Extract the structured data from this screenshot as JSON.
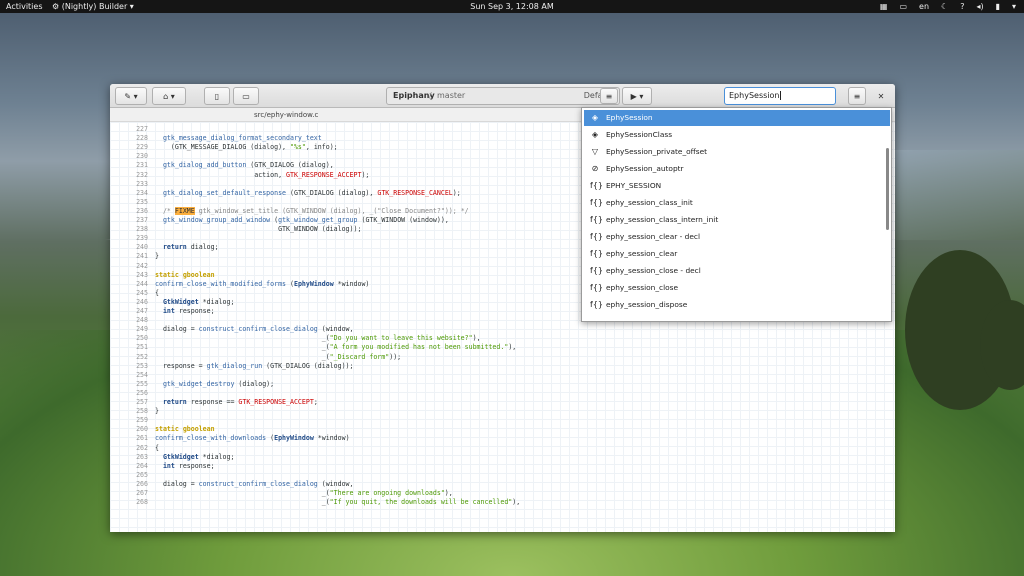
{
  "topbar": {
    "activities": "Activities",
    "app_icon": "wrench-icon",
    "app": "(Nightly) Builder ▾",
    "clock": "Sun Sep  3, 12:08 AM",
    "lang": "en"
  },
  "window": {
    "project": "Epiphany",
    "sep": "/",
    "branch": "master",
    "config": "Default",
    "search_value": "EphySession",
    "file_tab": "src/ephy-window.c"
  },
  "code": {
    "lines": [
      {
        "n": "227",
        "html": ""
      },
      {
        "n": "228",
        "html": "  <span class='fn'>gtk_message_dialog_format_secondary_text</span>"
      },
      {
        "n": "229",
        "html": "    (GTK_MESSAGE_DIALOG (dialog), <span class='str'>\"%s\"</span>, info);"
      },
      {
        "n": "230",
        "html": ""
      },
      {
        "n": "231",
        "html": "  <span class='fn'>gtk_dialog_add_button</span> (GTK_DIALOG (dialog),"
      },
      {
        "n": "232",
        "html": "                         action, <span class='mac'>GTK_RESPONSE_ACCEPT</span>);"
      },
      {
        "n": "233",
        "html": ""
      },
      {
        "n": "234",
        "html": "  <span class='fn'>gtk_dialog_set_default_response</span> (GTK_DIALOG (dialog), <span class='mac'>GTK_RESPONSE_CANCEL</span>);"
      },
      {
        "n": "235",
        "html": ""
      },
      {
        "n": "236",
        "html": "  <span class='cm'>/* <span class='hl'>FIXME</span> gtk_window_set_title (GTK_WINDOW (dialog), _(\"Close Document?\")); */</span>"
      },
      {
        "n": "237",
        "html": "  <span class='fn'>gtk_window_group_add_window</span> (<span class='fn'>gtk_window_get_group</span> (GTK_WINDOW (window)),"
      },
      {
        "n": "238",
        "html": "                               GTK_WINDOW (dialog));"
      },
      {
        "n": "239",
        "html": ""
      },
      {
        "n": "240",
        "html": "  <span class='kw2'>return</span> dialog;"
      },
      {
        "n": "241",
        "html": "}"
      },
      {
        "n": "242",
        "html": ""
      },
      {
        "n": "243",
        "html": "<span class='kw'>static</span> <span class='kw'>gboolean</span>"
      },
      {
        "n": "244",
        "html": "<span class='fn'>confirm_close_with_modified_forms</span> (<span class='kw2'>EphyWindow</span> *window)"
      },
      {
        "n": "245",
        "html": "{"
      },
      {
        "n": "246",
        "html": "  <span class='kw2'>GtkWidget</span> *dialog;"
      },
      {
        "n": "247",
        "html": "  <span class='kw2'>int</span> response;"
      },
      {
        "n": "248",
        "html": ""
      },
      {
        "n": "249",
        "html": "  dialog = <span class='fn'>construct_confirm_close_dialog</span> (window,"
      },
      {
        "n": "250",
        "html": "                                          _(<span class='str'>\"Do you want to leave this website?\"</span>),"
      },
      {
        "n": "251",
        "html": "                                          _(<span class='str'>\"A form you modified has not been submitted.\"</span>),"
      },
      {
        "n": "252",
        "html": "                                          _(<span class='str'>\"_Discard form\"</span>));"
      },
      {
        "n": "253",
        "html": "  response = <span class='fn'>gtk_dialog_run</span> (GTK_DIALOG (dialog));"
      },
      {
        "n": "254",
        "html": ""
      },
      {
        "n": "255",
        "html": "  <span class='fn'>gtk_widget_destroy</span> (dialog);"
      },
      {
        "n": "256",
        "html": ""
      },
      {
        "n": "257",
        "html": "  <span class='kw2'>return</span> response == <span class='mac'>GTK_RESPONSE_ACCEPT</span>;"
      },
      {
        "n": "258",
        "html": "}"
      },
      {
        "n": "259",
        "html": ""
      },
      {
        "n": "260",
        "html": "<span class='kw'>static</span> <span class='kw'>gboolean</span>"
      },
      {
        "n": "261",
        "html": "<span class='fn'>confirm_close_with_downloads</span> (<span class='kw2'>EphyWindow</span> *window)"
      },
      {
        "n": "262",
        "html": "{"
      },
      {
        "n": "263",
        "html": "  <span class='kw2'>GtkWidget</span> *dialog;"
      },
      {
        "n": "264",
        "html": "  <span class='kw2'>int</span> response;"
      },
      {
        "n": "265",
        "html": ""
      },
      {
        "n": "266",
        "html": "  dialog = <span class='fn'>construct_confirm_close_dialog</span> (window,"
      },
      {
        "n": "267",
        "html": "                                          _(<span class='str'>\"There are ongoing downloads\"</span>),"
      },
      {
        "n": "268",
        "html": "                                          _(<span class='str'>\"If you quit, the downloads will be cancelled\"</span>),"
      }
    ]
  },
  "completions": [
    {
      "icon": "class-icon",
      "glyph": "◈",
      "label": "EphySession",
      "selected": true
    },
    {
      "icon": "class-icon",
      "glyph": "◈",
      "label": "EphySessionClass"
    },
    {
      "icon": "field-icon",
      "glyph": "▽",
      "label": "EphySession_private_offset"
    },
    {
      "icon": "typedef-icon",
      "glyph": "⊘",
      "label": "EphySession_autoptr"
    },
    {
      "icon": "macro-icon",
      "glyph": "f{}",
      "label": "EPHY_SESSION"
    },
    {
      "icon": "function-icon",
      "glyph": "f{}",
      "label": "ephy_session_class_init"
    },
    {
      "icon": "function-icon",
      "glyph": "f{}",
      "label": "ephy_session_class_intern_init"
    },
    {
      "icon": "function-icon",
      "glyph": "f{}",
      "label": "ephy_session_clear - decl"
    },
    {
      "icon": "function-icon",
      "glyph": "f{}",
      "label": "ephy_session_clear"
    },
    {
      "icon": "function-icon",
      "glyph": "f{}",
      "label": "ephy_session_close - decl"
    },
    {
      "icon": "function-icon",
      "glyph": "f{}",
      "label": "ephy_session_close"
    },
    {
      "icon": "function-icon",
      "glyph": "f{}",
      "label": "ephy_session_dispose"
    }
  ]
}
